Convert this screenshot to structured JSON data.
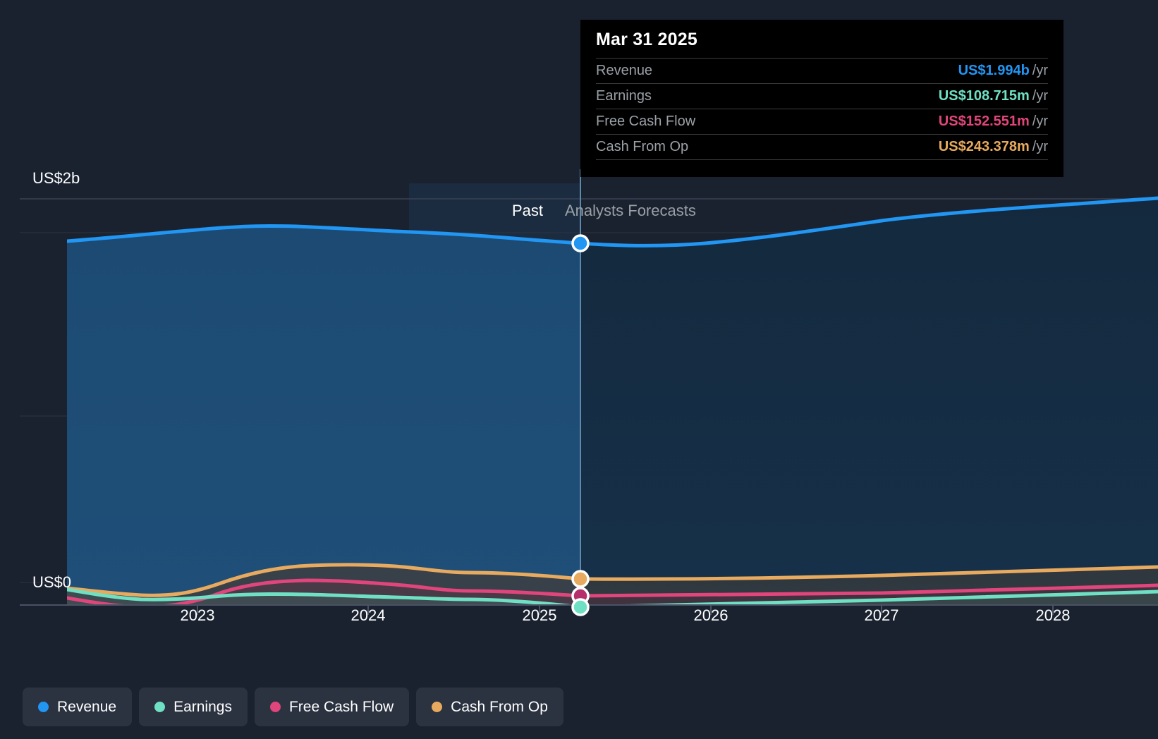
{
  "tooltip": {
    "date": "Mar 31 2025",
    "rows": [
      {
        "label": "Revenue",
        "value": "US$1.994b",
        "unit": "/yr",
        "color": "#2196f3"
      },
      {
        "label": "Earnings",
        "value": "US$108.715m",
        "unit": "/yr",
        "color": "#6fe0c4"
      },
      {
        "label": "Free Cash Flow",
        "value": "US$152.551m",
        "unit": "/yr",
        "color": "#e0457b"
      },
      {
        "label": "Cash From Op",
        "value": "US$243.378m",
        "unit": "/yr",
        "color": "#e8aa5e"
      }
    ]
  },
  "axis": {
    "y_labels": [
      "US$2b",
      "US$0"
    ],
    "x_labels": [
      "2023",
      "2024",
      "2025",
      "2026",
      "2027",
      "2028"
    ]
  },
  "bands": {
    "past": "Past",
    "forecast": "Analysts Forecasts"
  },
  "legend": [
    {
      "label": "Revenue",
      "color": "#2196f3"
    },
    {
      "label": "Earnings",
      "color": "#6fe0c4"
    },
    {
      "label": "Free Cash Flow",
      "color": "#e0457b"
    },
    {
      "label": "Cash From Op",
      "color": "#e8aa5e"
    }
  ],
  "chart_data": {
    "type": "area",
    "title": "Revenue, Earnings, Free Cash Flow and Cash From Op over time",
    "xlabel": "",
    "ylabel": "US$",
    "ylim": [
      0,
      2000
    ],
    "y_gridlines": [
      0,
      1000,
      2000
    ],
    "y_axis_ticks": [
      "US$0",
      "US$2b"
    ],
    "x_ticks": [
      "2023",
      "2024",
      "2025",
      "2026",
      "2027",
      "2028"
    ],
    "grid": true,
    "legend_position": "bottom-left",
    "forecast_divider_x": "2025.25",
    "highlight": {
      "date": "Mar 31 2025",
      "Revenue": 1994,
      "Earnings": 108.715,
      "Free Cash Flow": 152.551,
      "Cash From Op": 243.378,
      "units": "US$ millions per year"
    },
    "annotations": [
      "Past",
      "Analysts Forecasts"
    ],
    "x": [
      "2022.6",
      "2022.9",
      "2023.2",
      "2023.5",
      "2023.8",
      "2024.1",
      "2024.4",
      "2024.7",
      "2025.0",
      "2025.25",
      "2025.6",
      "2026.0",
      "2026.5",
      "2027.0",
      "2027.5",
      "2028.0",
      "2028.6"
    ],
    "series": [
      {
        "name": "Revenue",
        "color": "#2196f3",
        "values": [
          1925,
          1950,
          1985,
          2030,
          2040,
          2035,
          2030,
          2015,
          1999,
          1994,
          1985,
          2000,
          2045,
          2090,
          2135,
          2180,
          2225
        ]
      },
      {
        "name": "Earnings",
        "color": "#6fe0c4",
        "values": [
          85,
          60,
          45,
          62,
          78,
          80,
          76,
          74,
          80,
          109,
          112,
          118,
          126,
          134,
          142,
          150,
          158
        ]
      },
      {
        "name": "Free Cash Flow",
        "color": "#e0457b",
        "values": [
          35,
          10,
          5,
          60,
          128,
          140,
          132,
          128,
          148,
          153,
          152,
          156,
          163,
          170,
          178,
          186,
          194
        ]
      },
      {
        "name": "Cash From Op",
        "color": "#e8aa5e",
        "values": [
          120,
          100,
          92,
          150,
          218,
          238,
          240,
          228,
          236,
          243,
          240,
          242,
          248,
          254,
          262,
          270,
          278
        ]
      }
    ]
  }
}
